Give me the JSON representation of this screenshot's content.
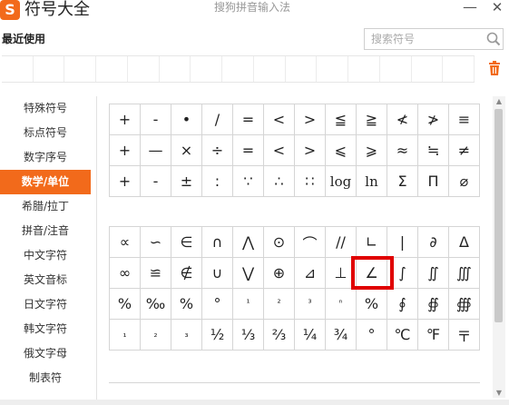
{
  "app": {
    "logo_text": "S",
    "title": "符号大全",
    "window_title": "搜狗拼音输入法",
    "minimize_glyph": "—",
    "close_glyph": "✕"
  },
  "recent": {
    "label": "最近使用",
    "cell_count": 15
  },
  "search": {
    "placeholder": "搜索符号",
    "icon": "search-icon"
  },
  "sidebar": {
    "active_index": 3,
    "items": [
      {
        "label": "特殊符号"
      },
      {
        "label": "标点符号"
      },
      {
        "label": "数字序号"
      },
      {
        "label": "数学/单位"
      },
      {
        "label": "希腊/拉丁"
      },
      {
        "label": "拼音/注音"
      },
      {
        "label": "中文字符"
      },
      {
        "label": "英文音标"
      },
      {
        "label": "日文字符"
      },
      {
        "label": "韩文字符"
      },
      {
        "label": "俄文字母"
      },
      {
        "label": "制表符"
      }
    ]
  },
  "grid1": [
    [
      "+",
      "-",
      "•",
      "/",
      "=",
      "<",
      ">",
      "≦",
      "≧",
      "≮",
      "≯",
      "≡"
    ],
    [
      "+",
      "—",
      "×",
      "÷",
      "=",
      "<",
      ">",
      "⩽",
      "⩾",
      "≈",
      "≒",
      "≠"
    ],
    [
      "+",
      "-",
      "±",
      ":",
      "∵",
      "∴",
      "∷",
      "log",
      "ln",
      "Σ",
      "Π",
      "⌀"
    ]
  ],
  "grid2": [
    [
      "∝",
      "∽",
      "∈",
      "∩",
      "⋀",
      "⊙",
      "⌒",
      "//",
      "∟",
      "|",
      "∂",
      "Δ"
    ],
    [
      "∞",
      "≌",
      "∉",
      "∪",
      "⋁",
      "⊕",
      "⊿",
      "⊥",
      "∠",
      "∫",
      "∬",
      "∭"
    ],
    [
      "%",
      "‰",
      "%",
      "°",
      "¹",
      "²",
      "³",
      "ⁿ",
      "%",
      "∮",
      "∯",
      "∰"
    ],
    [
      "₁",
      "₂",
      "₃",
      "½",
      "⅓",
      "⅔",
      "¼",
      "¾",
      "°",
      "℃",
      "℉",
      "〒"
    ]
  ],
  "selected": {
    "grid": 2,
    "row": 1,
    "col": 8
  },
  "colors": {
    "accent": "#f26a1b",
    "selection": "#e00000",
    "grid_line": "#d5d5d5"
  }
}
